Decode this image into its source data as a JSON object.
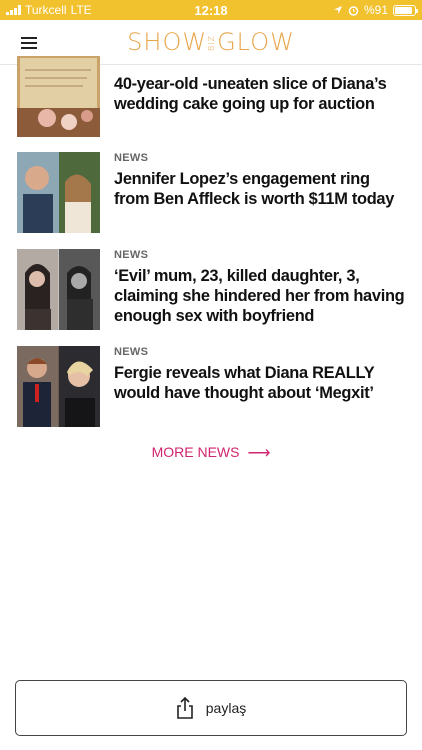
{
  "status_bar": {
    "carrier": "Turkcell",
    "network": "LTE",
    "time": "12:18",
    "battery": "%91",
    "battery_level": 0.91
  },
  "header": {
    "logo_left": "SHOW",
    "logo_mid": "BIZ",
    "logo_right": "GLOW",
    "menu_icon": "hamburger-menu-icon",
    "brand_color": "#e8a54a"
  },
  "news": [
    {
      "category": "",
      "headline": "40-year-old -uneaten slice of Diana’s wedding cake going up for auction"
    },
    {
      "category": "NEWS",
      "headline": "Jennifer Lopez’s engagement ring from Ben Affleck is worth $11M today"
    },
    {
      "category": "NEWS",
      "headline": "‘Evil’ mum, 23, killed daughter, 3, claiming she hindered her from having enough sex with boyfriend"
    },
    {
      "category": "NEWS",
      "headline": "Fergie reveals what Diana REALLY would have thought about ‘Megxit’"
    }
  ],
  "more_news": {
    "label": "MORE NEWS",
    "arrow": "⟶",
    "color": "#d0256f"
  },
  "share": {
    "label": "paylaş",
    "icon": "share-icon"
  }
}
